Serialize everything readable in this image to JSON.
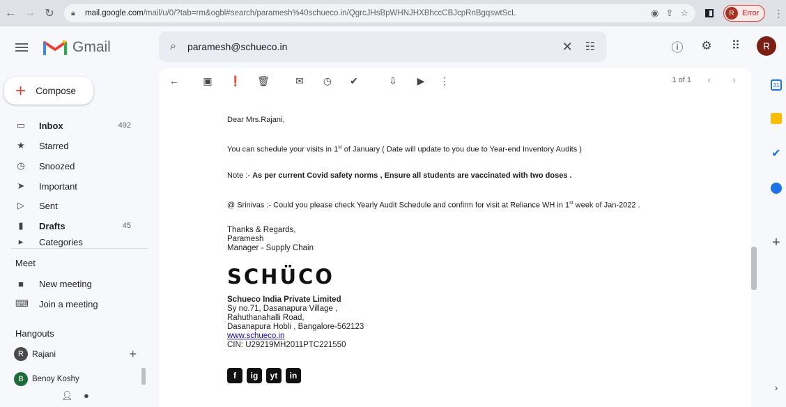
{
  "browser": {
    "url": "mail.google.com",
    "url_path": "/mail/u/0/?tab=rm&ogbl#search/paramesh%40schueco.in/QgrcJHsBpWHNJHXBhccCBJcpRnBgqswtScL",
    "profile_initial": "R",
    "profile_status": "Error"
  },
  "header": {
    "app_name": "Gmail",
    "search_value": "paramesh@schueco.in",
    "user_initial": "R"
  },
  "nav": {
    "compose_label": "Compose",
    "items": [
      {
        "label": "Inbox",
        "count": "492",
        "icon": "inbox-icon"
      },
      {
        "label": "Starred",
        "count": "",
        "icon": "star-icon"
      },
      {
        "label": "Snoozed",
        "count": "",
        "icon": "clock-icon"
      },
      {
        "label": "Important",
        "count": "",
        "icon": "important-icon"
      },
      {
        "label": "Sent",
        "count": "",
        "icon": "send-icon"
      },
      {
        "label": "Drafts",
        "count": "45",
        "icon": "draft-icon"
      },
      {
        "label": "Categories",
        "count": "",
        "icon": "label-icon"
      }
    ],
    "meet_title": "Meet",
    "meet_items": [
      "New meeting",
      "Join a meeting"
    ],
    "hangouts_title": "Hangouts",
    "hangout_user": "Rajani",
    "hangout_user_initial": "R",
    "hangout_contact": "Benoy Koshy",
    "hangout_contact_initial": "B"
  },
  "toolbar": {
    "pager": "1 of 1"
  },
  "email": {
    "greeting": "Dear  Mrs.Rajani,",
    "line1_pre": "You can schedule your visits in 1",
    "line1_sup": "st",
    "line1_post": " of January ( Date will update to you due to Year-end Inventory Audits )",
    "note_label": "Note :- ",
    "note_text": "As per current Covid safety norms , Ensure all students are vaccinated with two doses .",
    "line3_pre": "@ Srinivas :- Could you please check Yearly Audit Schedule and confirm for visit at Reliance WH in 1",
    "line3_sup": "st",
    "line3_post": " week of Jan-2022 .",
    "sign_off": "Thanks & Regards,",
    "sender_name": "Paramesh",
    "sender_title": "Manager -  Supply Chain",
    "brand": "SCHÜCO",
    "company": "Schueco India Private Limited",
    "addr1": "Sy no.71, Dasanapura Village ,",
    "addr2": "Rahuthanahalli Road,",
    "addr3": "Dasanapura Hobli , Bangalore-562123",
    "website": "www.schueco.in",
    "cin": "CIN: U29219MH2011PTC221550",
    "social": [
      "f",
      "ig",
      "yt",
      "in"
    ]
  }
}
